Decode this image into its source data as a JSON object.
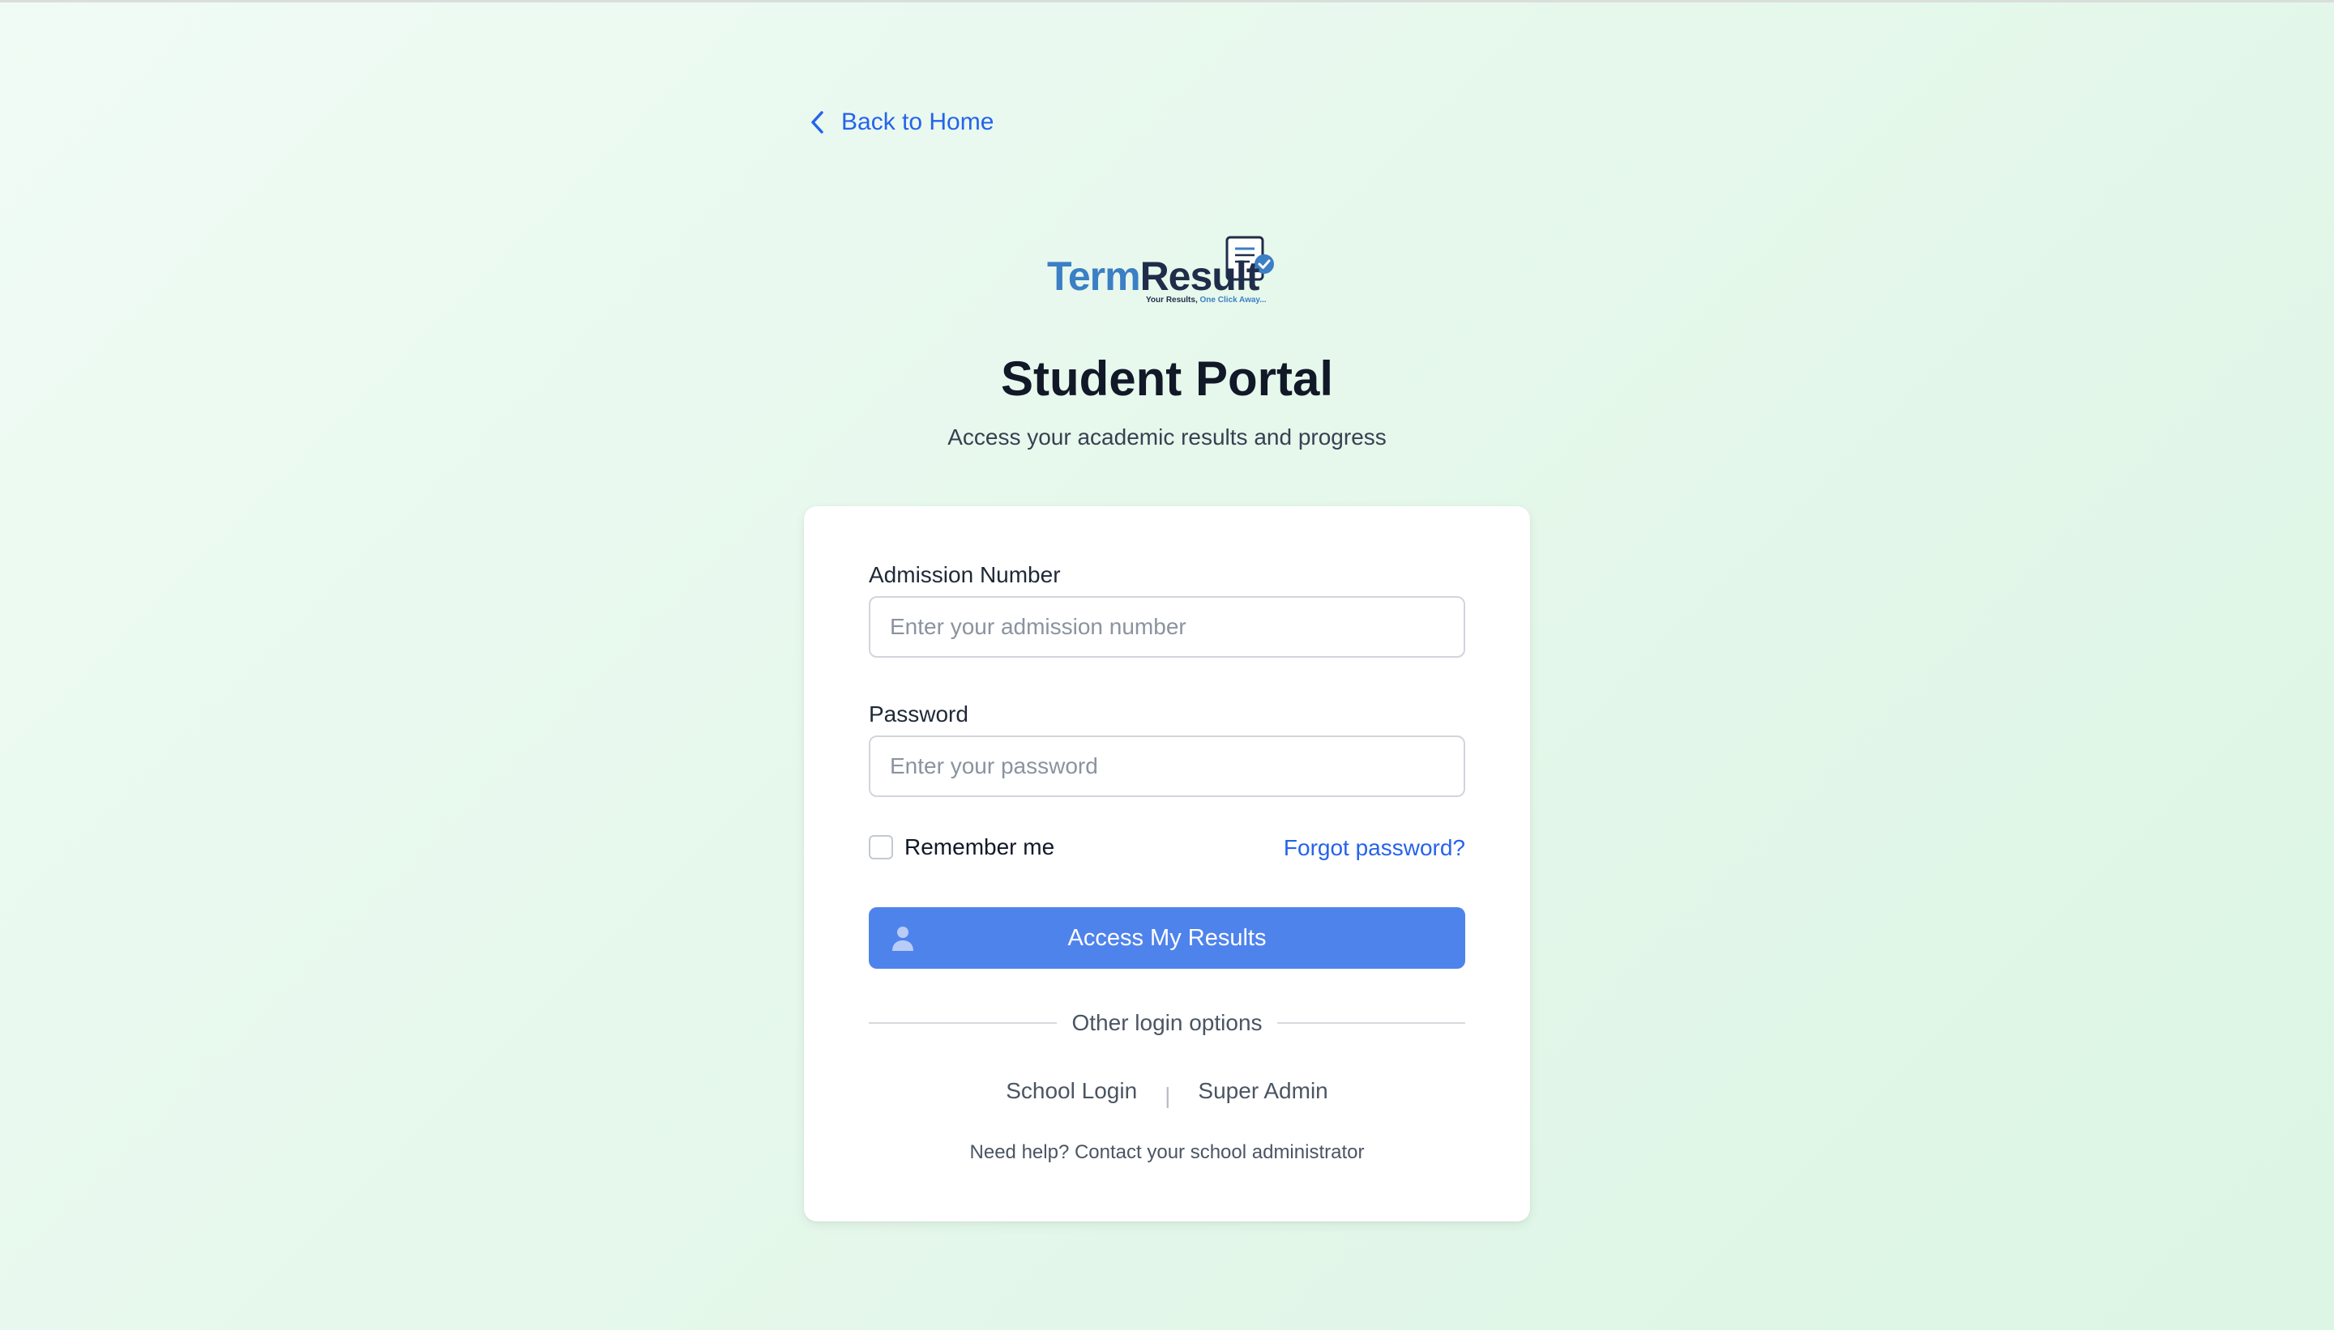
{
  "nav": {
    "back_label": "Back to Home"
  },
  "logo": {
    "part1": "Term",
    "part2": "Result",
    "tagline_a": "Your Results,",
    "tagline_b": "One Click Away..."
  },
  "header": {
    "title": "Student Portal",
    "subtitle": "Access your academic results and progress"
  },
  "form": {
    "admission": {
      "label": "Admission Number",
      "placeholder": "Enter your admission number",
      "value": ""
    },
    "password": {
      "label": "Password",
      "placeholder": "Enter your password",
      "value": ""
    },
    "remember_label": "Remember me",
    "remember_checked": false,
    "forgot_label": "Forgot password?",
    "submit_label": "Access My Results"
  },
  "other": {
    "divider_label": "Other login options",
    "school_login": "School Login",
    "separator": "|",
    "super_admin": "Super Admin",
    "help_text": "Need help? Contact your school administrator"
  },
  "colors": {
    "accent": "#2563eb",
    "button": "#4f83ec",
    "background": "#e6f8ec",
    "title": "#111827"
  }
}
